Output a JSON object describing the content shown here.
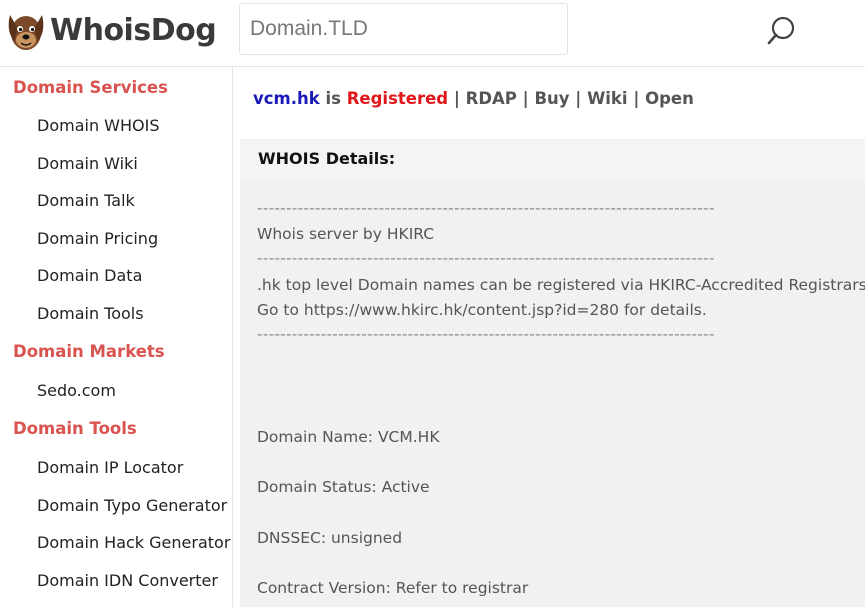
{
  "header": {
    "logo_text": "WhoisDog",
    "search_placeholder": "Domain.TLD"
  },
  "sidebar": {
    "sections": [
      {
        "title": "Domain Services",
        "items": [
          "Domain WHOIS",
          "Domain Wiki",
          "Domain Talk",
          "Domain Pricing",
          "Domain Data",
          "Domain Tools"
        ]
      },
      {
        "title": "Domain Markets",
        "items": [
          "Sedo.com"
        ]
      },
      {
        "title": "Domain Tools",
        "items": [
          "Domain IP Locator",
          "Domain Typo Generator",
          "Domain Hack Generator",
          "Domain IDN Converter"
        ]
      }
    ]
  },
  "status": {
    "domain": "vcm.hk",
    "is_text": "is",
    "state": "Registered",
    "links": [
      "RDAP",
      "Buy",
      "Wiki",
      "Open"
    ],
    "separator": "|"
  },
  "whois": {
    "title": "WHOIS Details:",
    "dashes": "-------------------------------------------------------------------------------",
    "server_line": "Whois server by HKIRC",
    "notice_line1": ".hk top level Domain names can be registered via HKIRC-Accredited Registrars.",
    "notice_line2": "Go to https://www.hkirc.hk/content.jsp?id=280 for details.",
    "fields": [
      "Domain Name: VCM.HK",
      "Domain Status: Active",
      "DNSSEC: unsigned",
      "Contract Version: Refer to registrar"
    ]
  },
  "colors": {
    "section_title": "#d9534f",
    "domain_link": "#1a1ab8",
    "registered": "#e0161a"
  }
}
